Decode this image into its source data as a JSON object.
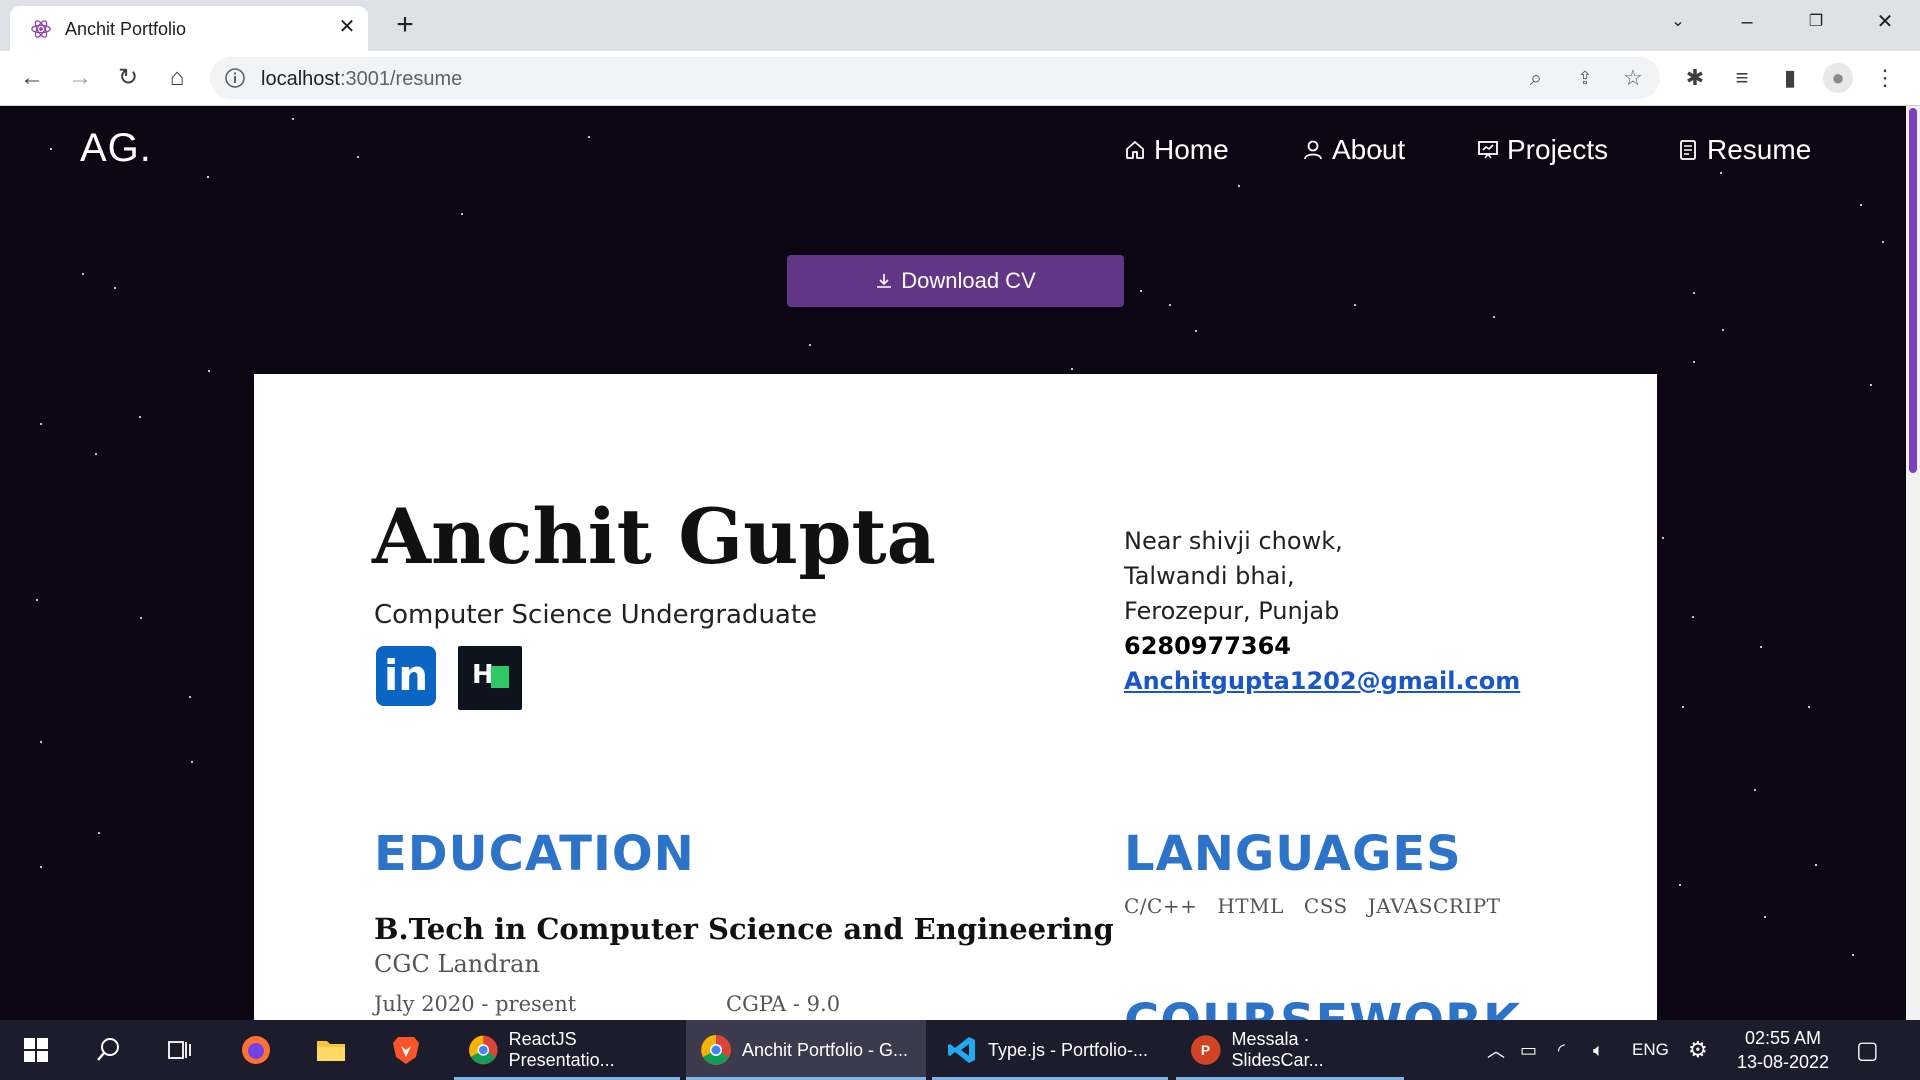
{
  "browser": {
    "tab_title": "Anchit Portfolio",
    "tab_close": "✕",
    "new_tab": "+",
    "url_host": "localhost",
    "url_path": ":3001/resume"
  },
  "navbar": {
    "logo": "AG.",
    "items": [
      {
        "label": "Home",
        "icon": "home-icon"
      },
      {
        "label": "About",
        "icon": "user-icon"
      },
      {
        "label": "Projects",
        "icon": "projects-icon"
      },
      {
        "label": "Resume",
        "icon": "document-icon"
      }
    ]
  },
  "download_label": "Download CV",
  "resume": {
    "name": "Anchit Gupta",
    "subtitle": "Computer Science Undergraduate",
    "address_lines": [
      "Near shivji chowk,",
      "Talwandi bhai,",
      "Ferozepur, Punjab"
    ],
    "phone": "6280977364",
    "email": "Anchitgupta1202@gmail.com",
    "education": {
      "heading": "EDUCATION",
      "degree": "B.Tech in Computer Science and Engineering",
      "college": "CGC Landran",
      "dates": "July 2020 - present",
      "cgpa": "CGPA - 9.0"
    },
    "languages": {
      "heading": "LANGUAGES",
      "items": [
        "C/C++",
        "HTML",
        "CSS",
        "JAVASCRIPT"
      ]
    },
    "coursework_heading": "COURSEWORK"
  },
  "taskbar": {
    "apps": [
      {
        "label": "ReactJS Presentatio...",
        "icon": "chrome-icon"
      },
      {
        "label": "Anchit Portfolio - G...",
        "icon": "chrome-icon"
      },
      {
        "label": "Type.js - Portfolio-...",
        "icon": "vscode-icon"
      },
      {
        "label": "Messala · SlidesCar...",
        "icon": "powerpoint-icon"
      }
    ],
    "language": "ENG",
    "time": "02:55 AM",
    "date": "13-08-2022"
  },
  "colors": {
    "accent": "#623686",
    "heading_blue": "#2d73c8",
    "page_bg": "#0c0513"
  }
}
